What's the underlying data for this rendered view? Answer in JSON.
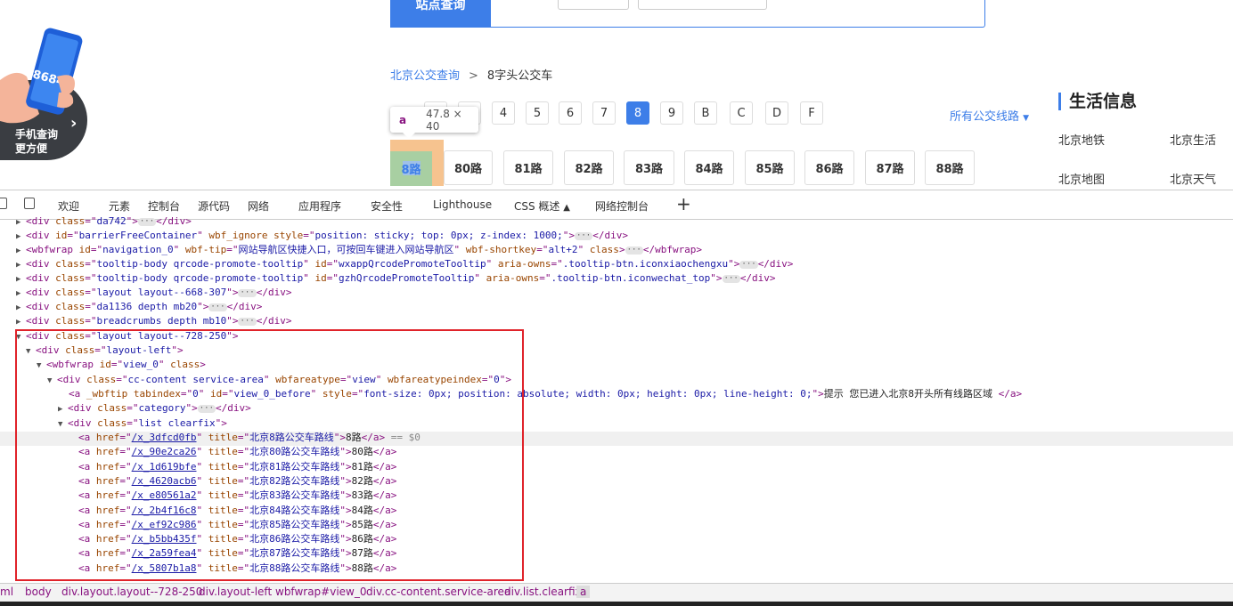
{
  "search": {
    "button_label": "站点查询"
  },
  "promo": {
    "phone_number": "8684",
    "line1": "手机查询",
    "line2": "更方便"
  },
  "breadcrumb": {
    "link": "北京公交查询",
    "separator": ">",
    "current": "8字头公交车"
  },
  "letters": [
    {
      "label": "4"
    },
    {
      "label": "5"
    },
    {
      "label": "6"
    },
    {
      "label": "7"
    },
    {
      "label": "8",
      "active": true
    },
    {
      "label": "9"
    },
    {
      "label": "B"
    },
    {
      "label": "C"
    },
    {
      "label": "D"
    },
    {
      "label": "F"
    }
  ],
  "all_routes_label": "所有公交线路",
  "life": {
    "title": "生活信息",
    "links": [
      "北京地铁",
      "北京生活",
      "北京地图",
      "北京天气"
    ]
  },
  "tooltip": {
    "tag": "a",
    "size": "47.8 × 40"
  },
  "routes": [
    "8路",
    "80路",
    "81路",
    "82路",
    "83路",
    "84路",
    "85路",
    "86路",
    "87路",
    "88路"
  ],
  "devtools": {
    "tabs": [
      "欢迎",
      "元素",
      "控制台",
      "源代码",
      "网络",
      "应用程序",
      "安全性",
      "Lighthouse",
      "CSS 概述",
      "网络控制台"
    ],
    "plus": "+",
    "selected_marker": "== $0",
    "hrefs": [
      "/x_3dfcd0fb",
      "/x_90e2ca26",
      "/x_1d619bfe",
      "/x_4620acb6",
      "/x_e80561a2",
      "/x_2b4f16c8",
      "/x_ef92c986",
      "/x_b5bb435f",
      "/x_2a59fea4",
      "/x_5807b1a8"
    ],
    "titles": [
      "北京8路公交车路线",
      "北京80路公交车路线",
      "北京81路公交车路线",
      "北京82路公交车路线",
      "北京83路公交车路线",
      "北京84路公交车路线",
      "北京85路公交车路线",
      "北京86路公交车路线",
      "北京87路公交车路线",
      "北京88路公交车路线"
    ],
    "texts": [
      "8路",
      "80路",
      "81路",
      "82路",
      "83路",
      "84路",
      "85路",
      "86路",
      "87路",
      "88路"
    ],
    "breadcrumbs": [
      "ml",
      "body",
      "div.layout.layout--728-250",
      "div.layout-left",
      "wbfwrap#view_0",
      "div.cc-content.service-area",
      "div.list.clearfix",
      "a"
    ]
  }
}
